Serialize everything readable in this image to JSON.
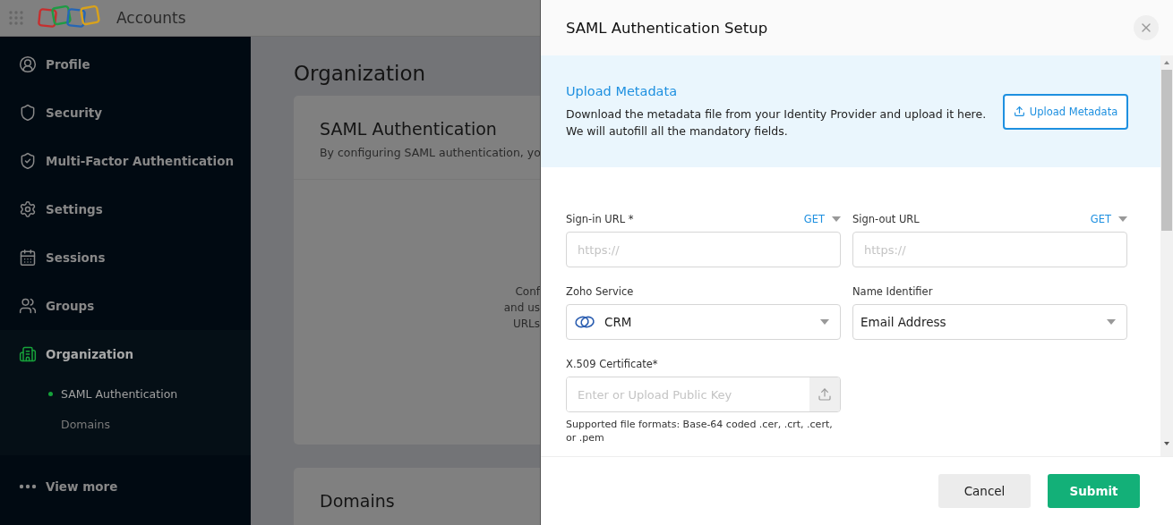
{
  "header": {
    "app_name": "Accounts"
  },
  "sidebar": {
    "items": [
      {
        "label": "Profile",
        "kind": "profile",
        "selected": false
      },
      {
        "label": "Security",
        "kind": "shield",
        "selected": false
      },
      {
        "label": "Multi-Factor Authentication",
        "kind": "shield-check",
        "selected": false
      },
      {
        "label": "Settings",
        "kind": "gear",
        "selected": false
      },
      {
        "label": "Sessions",
        "kind": "calendar",
        "selected": false
      },
      {
        "label": "Groups",
        "kind": "users",
        "selected": false
      },
      {
        "label": "Organization",
        "kind": "building",
        "selected": true,
        "children": [
          {
            "label": "SAML Authentication",
            "selected": true
          },
          {
            "label": "Domains",
            "selected": false
          }
        ]
      }
    ],
    "view_more": "View more"
  },
  "main": {
    "title": "Organization",
    "cards": [
      {
        "title": "SAML Authentication",
        "subtitle": "By configuring SAML authentication, yo",
        "body_lines": [
          "Conf",
          "and us",
          "URLs"
        ]
      },
      {
        "title": "Domains"
      }
    ]
  },
  "drawer": {
    "title": "SAML Authentication Setup",
    "upload": {
      "title": "Upload Metadata",
      "lines": [
        "Download the metadata file from your Identity Provider and upload it here.",
        "We will autofill all the mandatory fields."
      ],
      "button": "Upload Metadata"
    },
    "fields": [
      {
        "kind": "url",
        "label": "Sign-in URL *",
        "method": "GET",
        "placeholder": "https://"
      },
      {
        "kind": "url",
        "label": "Sign-out URL",
        "method": "GET",
        "placeholder": "https://"
      },
      {
        "kind": "select",
        "label": "Zoho Service",
        "value": "CRM",
        "service_icon": true
      },
      {
        "kind": "select",
        "label": "Name Identifier",
        "value": "Email Address",
        "service_icon": false
      },
      {
        "kind": "file",
        "label": "X.509 Certificate*",
        "placeholder": "Enter or Upload Public Key",
        "hint": "Supported file formats: Base-64 coded .cer, .crt, .cert, or .pem"
      }
    ],
    "buttons": [
      {
        "label": "Cancel",
        "kind": "secondary"
      },
      {
        "label": "Submit",
        "kind": "primary"
      }
    ]
  }
}
